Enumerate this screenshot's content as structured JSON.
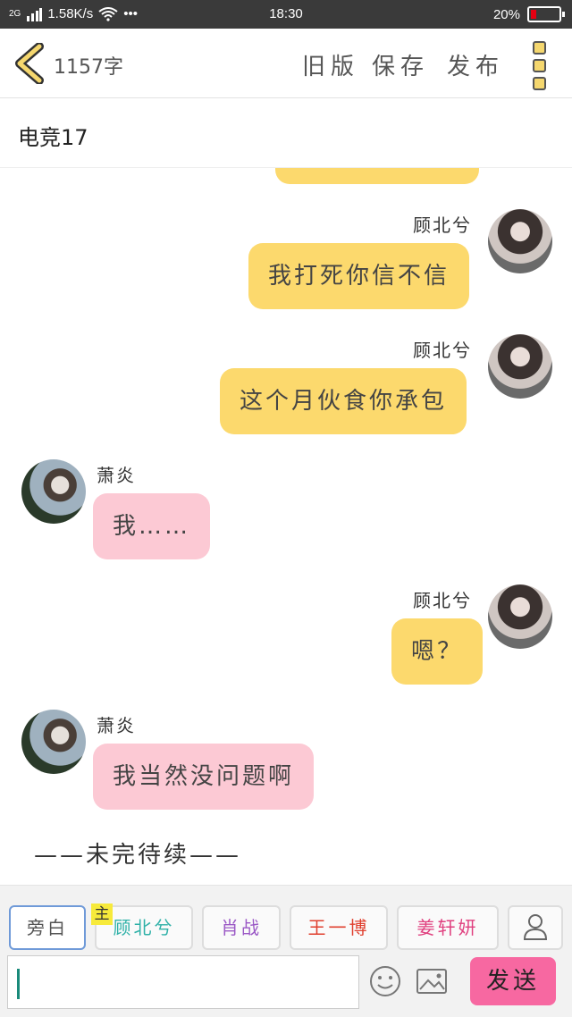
{
  "status_bar": {
    "network": "2G",
    "speed": "1.58K/s",
    "dots": "•••",
    "time": "18:30",
    "battery": "20%"
  },
  "header": {
    "word_count": "1157字",
    "old_version": "旧版",
    "save": "保存",
    "publish": "发布"
  },
  "chapter_title": "电竞17",
  "messages": [
    {
      "side": "right",
      "name": "顾北兮",
      "text": "我打死你信不信",
      "bubble_color": "#fcd96d"
    },
    {
      "side": "right",
      "name": "顾北兮",
      "text": "这个月伙食你承包",
      "bubble_color": "#fcd96d"
    },
    {
      "side": "left",
      "name": "萧炎",
      "text": "我……",
      "bubble_color": "#fcc9d4"
    },
    {
      "side": "right",
      "name": "顾北兮",
      "text": "嗯？",
      "bubble_color": "#fcd96d"
    },
    {
      "side": "left",
      "name": "萧炎",
      "text": "我当然没问题啊",
      "bubble_color": "#fcc9d4"
    }
  ],
  "ending_text": "——未完待续——",
  "roles": [
    {
      "label": "旁白",
      "color": "#666666"
    },
    {
      "label": "顾北兮",
      "color": "#2fb1a8",
      "tag": "主"
    },
    {
      "label": "肖战",
      "color": "#9b59c6"
    },
    {
      "label": "王一博",
      "color": "#e0402f"
    },
    {
      "label": "姜轩妍",
      "color": "#e0407f"
    }
  ],
  "composer": {
    "input_value": "",
    "send_label": "发送"
  },
  "icons": [
    "back-chevron-icon",
    "menu-dots-icon",
    "person-icon",
    "emoji-icon",
    "image-icon",
    "wifi-icon",
    "battery-icon"
  ]
}
